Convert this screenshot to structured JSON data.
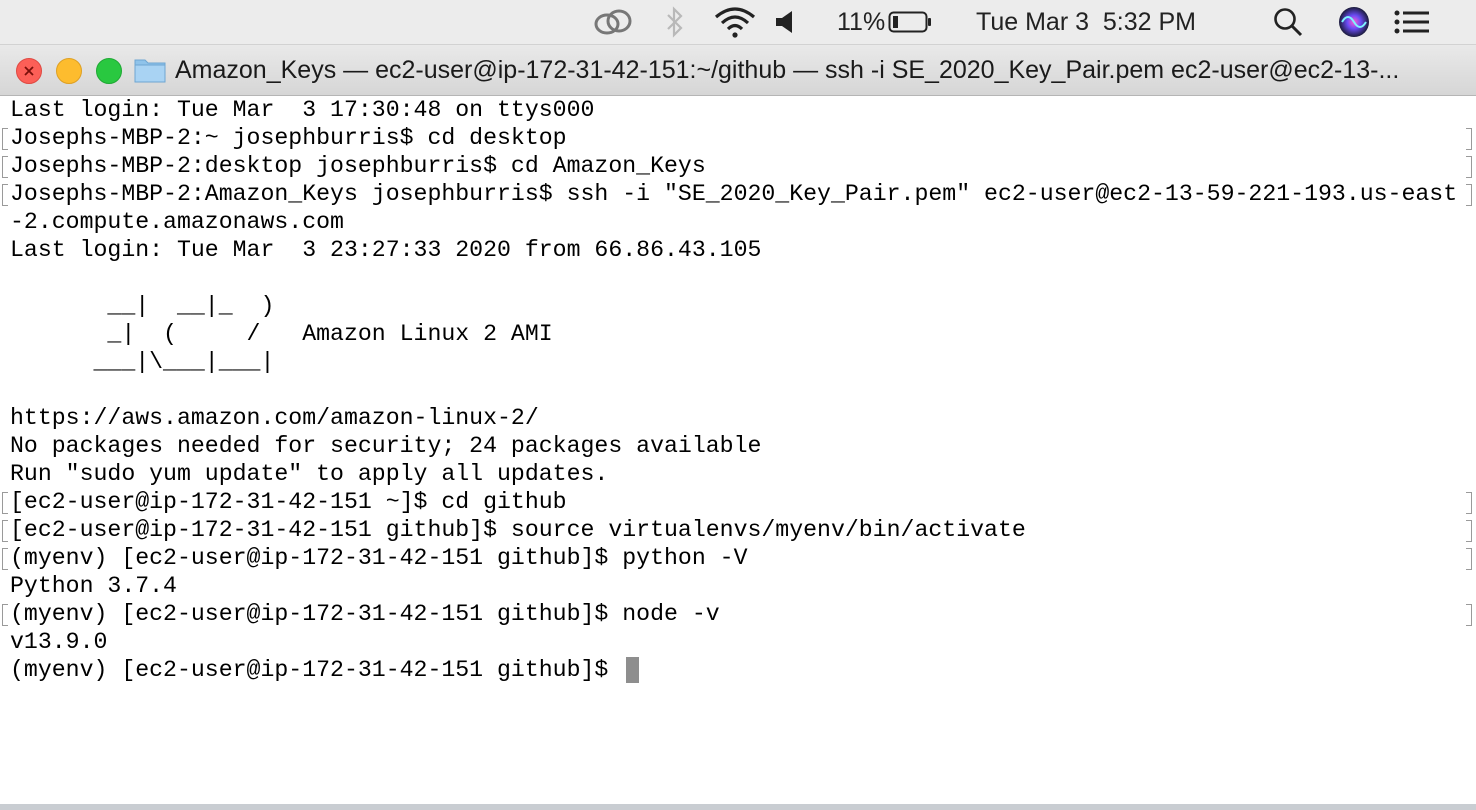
{
  "menubar": {
    "battery_percent": "11%",
    "datetime": "Tue Mar 3  5:32 PM",
    "icons": [
      "creative-cloud-icon",
      "bluetooth-icon",
      "wifi-icon",
      "volume-icon",
      "battery-icon",
      "spotlight-search-icon",
      "siri-icon",
      "notification-center-icon"
    ]
  },
  "window": {
    "title": "Amazon_Keys — ec2-user@ip-172-31-42-151:~/github — ssh -i SE_2020_Key_Pair.pem ec2-user@ec2-13-...",
    "traffic_lights": {
      "close": "#fc5f57",
      "minimize": "#fdbc2e",
      "zoom": "#29c840"
    }
  },
  "terminal": {
    "lines": [
      "Last login: Tue Mar  3 17:30:48 on ttys000",
      "Josephs-MBP-2:~ josephburris$ cd desktop",
      "Josephs-MBP-2:desktop josephburris$ cd Amazon_Keys",
      "Josephs-MBP-2:Amazon_Keys josephburris$ ssh -i \"SE_2020_Key_Pair.pem\" ec2-user@ec2-13-59-221-193.us-east",
      "-2.compute.amazonaws.com",
      "Last login: Tue Mar  3 23:27:33 2020 from 66.86.43.105",
      "",
      "       __|  __|_  )",
      "       _|  (     /   Amazon Linux 2 AMI",
      "      ___|\\___|___|",
      "",
      "https://aws.amazon.com/amazon-linux-2/",
      "No packages needed for security; 24 packages available",
      "Run \"sudo yum update\" to apply all updates.",
      "[ec2-user@ip-172-31-42-151 ~]$ cd github",
      "[ec2-user@ip-172-31-42-151 github]$ source virtualenvs/myenv/bin/activate",
      "(myenv) [ec2-user@ip-172-31-42-151 github]$ python -V",
      "Python 3.7.4",
      "(myenv) [ec2-user@ip-172-31-42-151 github]$ node -v",
      "v13.9.0",
      "(myenv) [ec2-user@ip-172-31-42-151 github]$ "
    ]
  }
}
